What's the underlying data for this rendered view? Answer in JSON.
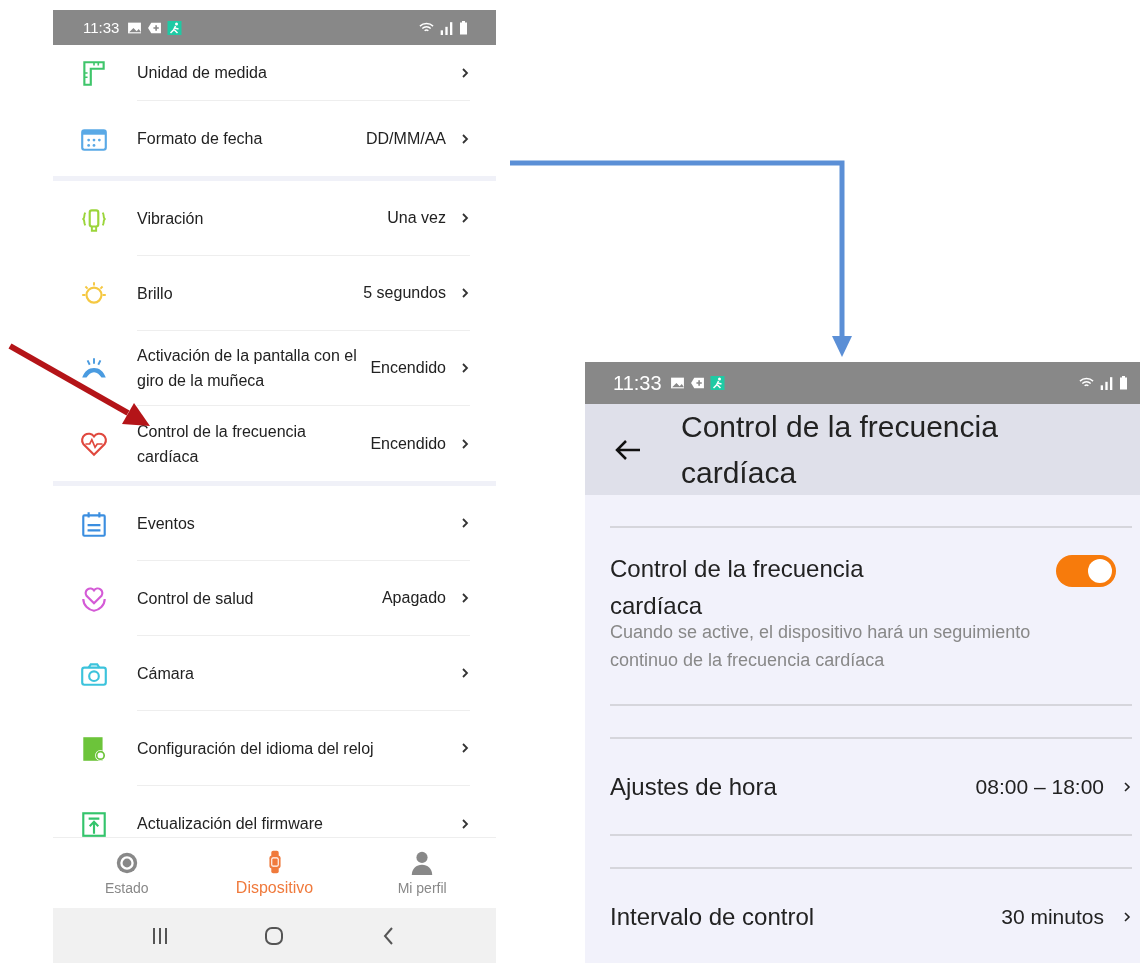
{
  "left_screen": {
    "status_bar": {
      "time": "11:33"
    },
    "menu_groups": [
      {
        "items": [
          {
            "label": "Unidad de medida"
          },
          {
            "label": "Formato de fecha",
            "value": "DD/MM/AA"
          }
        ]
      },
      {
        "items": [
          {
            "label": "Vibración",
            "value": "Una vez"
          },
          {
            "label": "Brillo",
            "value": "5 segundos"
          },
          {
            "label": "Activación de la pantalla con el giro de la muñeca",
            "value": "Encendido"
          },
          {
            "label": "Control de la frecuencia cardíaca",
            "value": "Encendido"
          }
        ]
      },
      {
        "items": [
          {
            "label": "Eventos"
          },
          {
            "label": "Control de salud",
            "value": "Apagado"
          },
          {
            "label": "Cámara"
          },
          {
            "label": "Configuración del idioma del reloj"
          },
          {
            "label": "Actualización del firmware"
          }
        ]
      }
    ],
    "bottom_tabs": [
      {
        "label": "Estado",
        "selected": false
      },
      {
        "label": "Dispositivo",
        "selected": true
      },
      {
        "label": "Mi perfil",
        "selected": false
      }
    ]
  },
  "right_screen": {
    "status_bar": {
      "time": "11:33"
    },
    "header": {
      "title": "Control de la frecuencia cardíaca"
    },
    "settings": [
      {
        "kind": "toggle",
        "label": "Control de la frecuencia cardíaca",
        "description": "Cuando se active, el dispositivo hará un seguimiento continuo de la frecuencia cardíaca",
        "on": true
      },
      {
        "kind": "value",
        "label": "Ajustes de hora",
        "value": "08:00 – 18:00"
      },
      {
        "kind": "value",
        "label": "Intervalo de control",
        "value": "30 minutos"
      }
    ]
  }
}
